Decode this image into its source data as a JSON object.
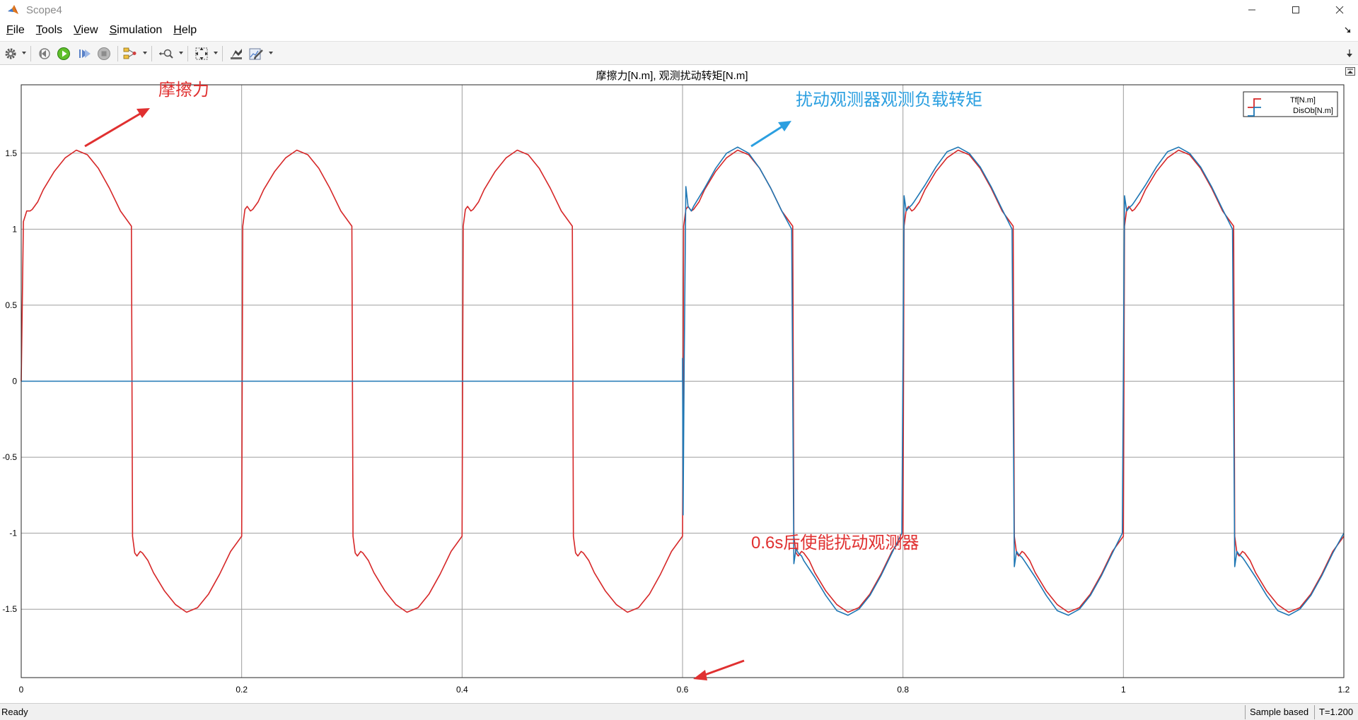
{
  "window": {
    "title": "Scope4"
  },
  "menu": [
    {
      "u": "F",
      "rest": "ile"
    },
    {
      "u": "T",
      "rest": "ools"
    },
    {
      "u": "V",
      "rest": "iew"
    },
    {
      "u": "S",
      "rest": "imulation"
    },
    {
      "u": "H",
      "rest": "elp"
    }
  ],
  "status": {
    "ready": "Ready",
    "mode": "Sample based",
    "time": "T=1.200"
  },
  "annotations": {
    "friction": "摩擦力",
    "observer": "扰动观测器观测负载转矩",
    "enable": "0.6s后使能扰动观测器"
  },
  "colors": {
    "tf": "#d62728",
    "disob": "#1f77b4",
    "annotation_red": "#e03030",
    "annotation_blue": "#2b9fe0",
    "grid": "#9e9e9e"
  },
  "chart_data": {
    "type": "line",
    "title": "摩擦力[N.m], 观测扰动转矩[N.m]",
    "xlim": [
      0,
      1.2
    ],
    "ylim": [
      -1.95,
      1.95
    ],
    "xticks": [
      0,
      0.2,
      0.4,
      0.6,
      0.8,
      1,
      1.2
    ],
    "xtick_labels": [
      "0",
      "0.2",
      "0.4",
      "0.6",
      "0.8",
      "1",
      "1.2"
    ],
    "yticks": [
      1.5,
      1,
      0.5,
      0,
      -0.5,
      -1,
      -1.5
    ],
    "ytick_labels": [
      "1.5",
      "1",
      "0.5",
      "0",
      "-0.5",
      "-1",
      "-1.5"
    ],
    "grid": true,
    "legend_position": "top-right",
    "series": [
      {
        "name": "Tf[N.m]",
        "color": "#d62728",
        "x": [
          0,
          0.002,
          0.005,
          0.008,
          0.01,
          0.015,
          0.02,
          0.03,
          0.04,
          0.05,
          0.06,
          0.07,
          0.08,
          0.09,
          0.1,
          0.101,
          0.103,
          0.105,
          0.108,
          0.11,
          0.115,
          0.12,
          0.13,
          0.14,
          0.15,
          0.16,
          0.17,
          0.18,
          0.19,
          0.2,
          0.201,
          0.203,
          0.205,
          0.208,
          0.21,
          0.215,
          0.22,
          0.23,
          0.24,
          0.25,
          0.26,
          0.27,
          0.28,
          0.29,
          0.3,
          0.301,
          0.303,
          0.305,
          0.308,
          0.31,
          0.315,
          0.32,
          0.33,
          0.34,
          0.35,
          0.36,
          0.37,
          0.38,
          0.39,
          0.4,
          0.401,
          0.403,
          0.405,
          0.408,
          0.41,
          0.415,
          0.42,
          0.43,
          0.44,
          0.45,
          0.46,
          0.47,
          0.48,
          0.49,
          0.5,
          0.501,
          0.503,
          0.505,
          0.508,
          0.51,
          0.515,
          0.52,
          0.53,
          0.54,
          0.55,
          0.56,
          0.57,
          0.58,
          0.59,
          0.6,
          0.601,
          0.603,
          0.605,
          0.608,
          0.61,
          0.615,
          0.62,
          0.63,
          0.64,
          0.65,
          0.66,
          0.67,
          0.68,
          0.69,
          0.7,
          0.701,
          0.703,
          0.705,
          0.708,
          0.71,
          0.715,
          0.72,
          0.73,
          0.74,
          0.75,
          0.76,
          0.77,
          0.78,
          0.79,
          0.8,
          0.801,
          0.803,
          0.805,
          0.808,
          0.81,
          0.815,
          0.82,
          0.83,
          0.84,
          0.85,
          0.86,
          0.87,
          0.88,
          0.89,
          0.9,
          0.901,
          0.903,
          0.905,
          0.908,
          0.91,
          0.915,
          0.92,
          0.93,
          0.94,
          0.95,
          0.96,
          0.97,
          0.98,
          0.99,
          1,
          1.001,
          1.003,
          1.005,
          1.008,
          1.01,
          1.015,
          1.02,
          1.03,
          1.04,
          1.05,
          1.06,
          1.07,
          1.08,
          1.09,
          1.1,
          1.101,
          1.103,
          1.105,
          1.108,
          1.11,
          1.115,
          1.12,
          1.13,
          1.14,
          1.15,
          1.16,
          1.17,
          1.18,
          1.19,
          1.2
        ],
        "y": [
          0,
          1.05,
          1.12,
          1.12,
          1.13,
          1.18,
          1.26,
          1.38,
          1.47,
          1.52,
          1.49,
          1.4,
          1.27,
          1.12,
          1.02,
          -1.02,
          -1.13,
          -1.15,
          -1.12,
          -1.13,
          -1.18,
          -1.26,
          -1.38,
          -1.47,
          -1.52,
          -1.49,
          -1.4,
          -1.27,
          -1.12,
          -1.02,
          1.02,
          1.13,
          1.15,
          1.12,
          1.13,
          1.18,
          1.26,
          1.38,
          1.47,
          1.52,
          1.49,
          1.4,
          1.27,
          1.12,
          1.02,
          -1.02,
          -1.13,
          -1.15,
          -1.12,
          -1.13,
          -1.18,
          -1.26,
          -1.38,
          -1.47,
          -1.52,
          -1.49,
          -1.4,
          -1.27,
          -1.12,
          -1.02,
          1.02,
          1.13,
          1.15,
          1.12,
          1.13,
          1.18,
          1.26,
          1.38,
          1.47,
          1.52,
          1.49,
          1.4,
          1.27,
          1.12,
          1.02,
          -1.02,
          -1.13,
          -1.15,
          -1.12,
          -1.13,
          -1.18,
          -1.26,
          -1.38,
          -1.47,
          -1.52,
          -1.49,
          -1.4,
          -1.27,
          -1.12,
          -1.02,
          1.02,
          1.13,
          1.15,
          1.12,
          1.13,
          1.18,
          1.26,
          1.38,
          1.47,
          1.52,
          1.49,
          1.4,
          1.27,
          1.12,
          1.02,
          -1.02,
          -1.13,
          -1.15,
          -1.12,
          -1.13,
          -1.18,
          -1.26,
          -1.38,
          -1.47,
          -1.52,
          -1.49,
          -1.4,
          -1.27,
          -1.12,
          -1.02,
          1.02,
          1.13,
          1.15,
          1.12,
          1.13,
          1.18,
          1.26,
          1.38,
          1.47,
          1.52,
          1.49,
          1.4,
          1.27,
          1.12,
          1.02,
          -1.02,
          -1.13,
          -1.15,
          -1.12,
          -1.13,
          -1.18,
          -1.26,
          -1.38,
          -1.47,
          -1.52,
          -1.49,
          -1.4,
          -1.27,
          -1.12,
          -1.02,
          1.02,
          1.13,
          1.15,
          1.12,
          1.13,
          1.18,
          1.26,
          1.38,
          1.47,
          1.52,
          1.49,
          1.4,
          1.27,
          1.12,
          1.02,
          -1.02,
          -1.13,
          -1.15,
          -1.12,
          -1.13,
          -1.18,
          -1.26,
          -1.38,
          -1.47,
          -1.52,
          -1.49,
          -1.4,
          -1.27,
          -1.12,
          -1.02
        ]
      },
      {
        "name": "DisOb[N.m]",
        "color": "#1f77b4",
        "x": [
          0,
          0.6,
          0.6,
          0.6005,
          0.6015,
          0.603,
          0.605,
          0.608,
          0.61,
          0.62,
          0.63,
          0.64,
          0.65,
          0.66,
          0.67,
          0.68,
          0.69,
          0.699,
          0.701,
          0.703,
          0.705,
          0.708,
          0.71,
          0.72,
          0.73,
          0.74,
          0.75,
          0.76,
          0.77,
          0.78,
          0.79,
          0.799,
          0.801,
          0.803,
          0.805,
          0.808,
          0.81,
          0.82,
          0.83,
          0.84,
          0.85,
          0.86,
          0.87,
          0.88,
          0.89,
          0.899,
          0.901,
          0.903,
          0.905,
          0.908,
          0.91,
          0.92,
          0.93,
          0.94,
          0.95,
          0.96,
          0.97,
          0.98,
          0.99,
          0.999,
          1.001,
          1.003,
          1.005,
          1.008,
          1.01,
          1.02,
          1.03,
          1.04,
          1.05,
          1.06,
          1.07,
          1.08,
          1.09,
          1.099,
          1.101,
          1.103,
          1.105,
          1.108,
          1.11,
          1.12,
          1.13,
          1.14,
          1.15,
          1.16,
          1.17,
          1.18,
          1.19,
          1.2
        ],
        "y": [
          0,
          0,
          0.15,
          -0.88,
          0.1,
          1.28,
          1.15,
          1.12,
          1.15,
          1.27,
          1.4,
          1.5,
          1.54,
          1.5,
          1.4,
          1.27,
          1.12,
          1.0,
          -1.2,
          -1.1,
          -1.13,
          -1.15,
          -1.18,
          -1.29,
          -1.41,
          -1.51,
          -1.54,
          -1.5,
          -1.41,
          -1.28,
          -1.13,
          -1.0,
          1.22,
          1.12,
          1.14,
          1.16,
          1.18,
          1.29,
          1.41,
          1.51,
          1.54,
          1.5,
          1.41,
          1.28,
          1.13,
          1.0,
          -1.22,
          -1.12,
          -1.14,
          -1.16,
          -1.18,
          -1.29,
          -1.41,
          -1.51,
          -1.54,
          -1.5,
          -1.41,
          -1.28,
          -1.13,
          -1.0,
          1.22,
          1.12,
          1.14,
          1.16,
          1.18,
          1.29,
          1.41,
          1.51,
          1.54,
          1.5,
          1.41,
          1.28,
          1.13,
          1.0,
          -1.22,
          -1.12,
          -1.14,
          -1.16,
          -1.18,
          -1.29,
          -1.41,
          -1.51,
          -1.54,
          -1.5,
          -1.41,
          -1.28,
          -1.13,
          -1.0
        ]
      }
    ]
  }
}
